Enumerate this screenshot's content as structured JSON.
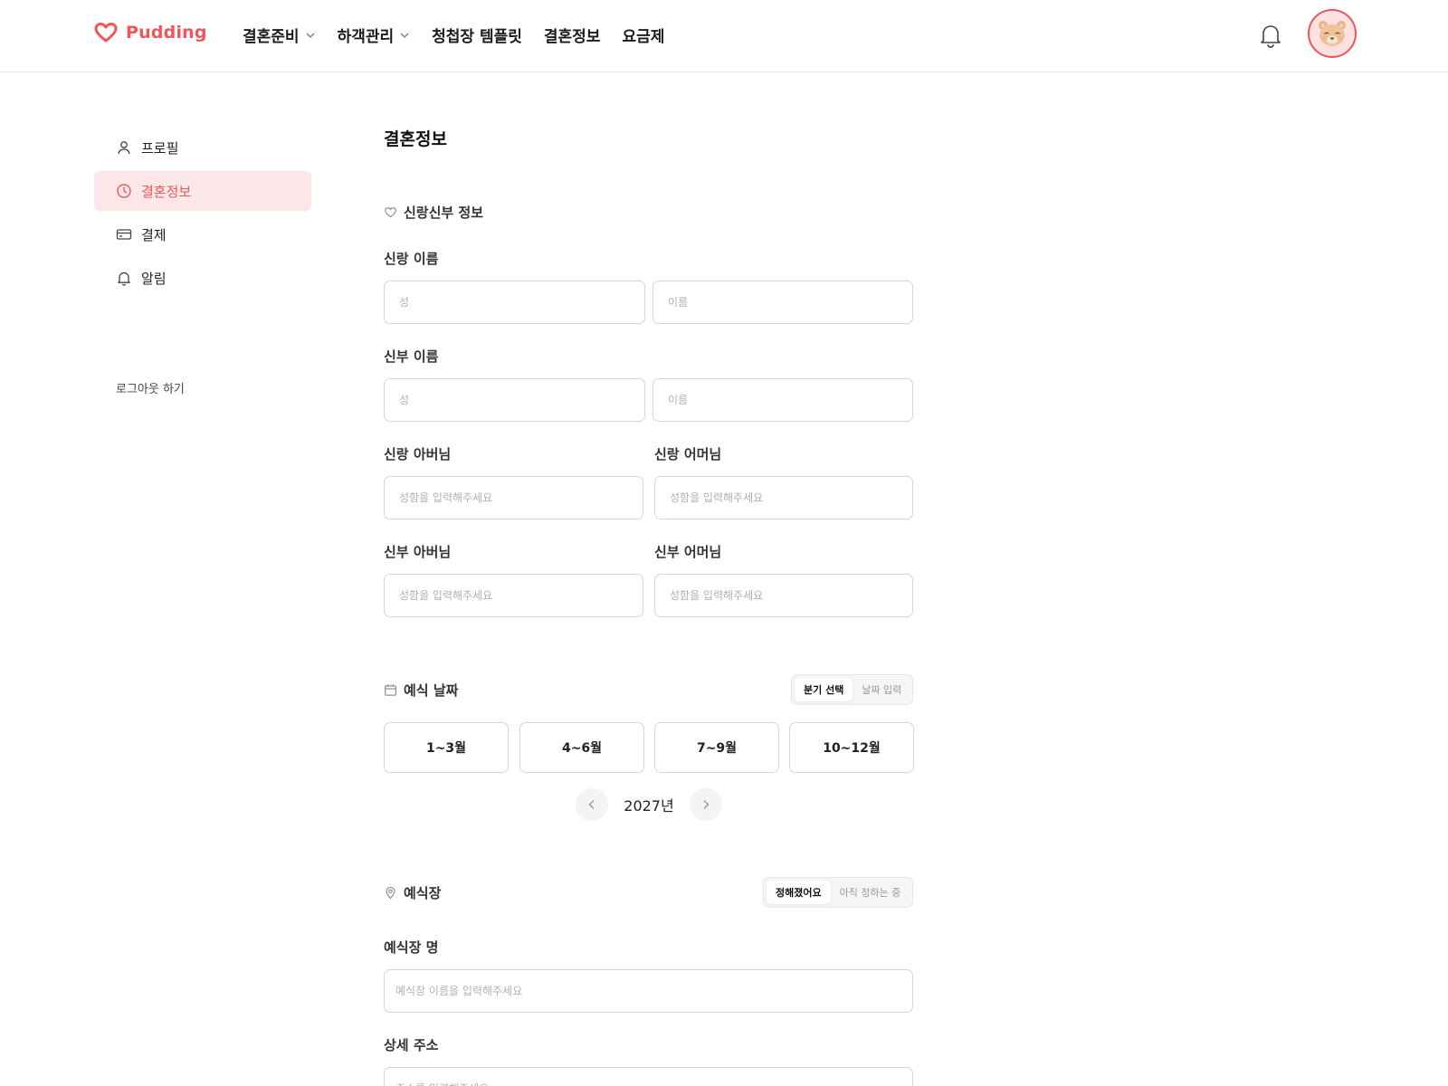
{
  "header": {
    "logo_text": "Pudding",
    "nav": [
      {
        "label": "결혼준비",
        "has_dropdown": true
      },
      {
        "label": "하객관리",
        "has_dropdown": true
      },
      {
        "label": "청첩장 템플릿",
        "has_dropdown": false
      },
      {
        "label": "결혼정보",
        "has_dropdown": false
      },
      {
        "label": "요금제",
        "has_dropdown": false
      }
    ],
    "icons": {
      "notifications": "bell-icon",
      "avatar": "bear-avatar"
    }
  },
  "sidebar": {
    "items": [
      {
        "label": "프로필",
        "icon": "user-icon",
        "active": false
      },
      {
        "label": "결혼정보",
        "icon": "clock-icon",
        "active": true
      },
      {
        "label": "결제",
        "icon": "card-icon",
        "active": false
      },
      {
        "label": "알림",
        "icon": "bell-icon",
        "active": false
      }
    ],
    "logout": "로그아웃 하기"
  },
  "main": {
    "title": "결혼정보",
    "couple_section": {
      "heading": "신랑신부 정보",
      "groom_name_label": "신랑 이름",
      "bride_name_label": "신부 이름",
      "last_name_placeholder": "성",
      "first_name_placeholder": "이름",
      "groom_father_label": "신랑 아버님",
      "groom_mother_label": "신랑 어머님",
      "bride_father_label": "신부 아버님",
      "bride_mother_label": "신부 어머님",
      "parent_placeholder": "성함을 입력해주세요"
    },
    "date_section": {
      "heading": "예식 날짜",
      "toggle": [
        "분기 선택",
        "날짜 입력"
      ],
      "toggle_selected": 0,
      "quarters": [
        "1~3월",
        "4~6월",
        "7~9월",
        "10~12월"
      ],
      "year": "2027년"
    },
    "venue_section": {
      "heading": "예식장",
      "toggle": [
        "정해졌어요",
        "아직 정하는 중"
      ],
      "toggle_selected": 0,
      "venue_name_label": "예식장 명",
      "venue_name_placeholder": "예식장 이름을 입력해주세요",
      "address_label": "상세 주소",
      "address_placeholder": "주소를 입력해주세요"
    }
  },
  "colors": {
    "accent": "#f0555a",
    "active_bg": "#fde8e9",
    "border": "#d6d6d6"
  }
}
